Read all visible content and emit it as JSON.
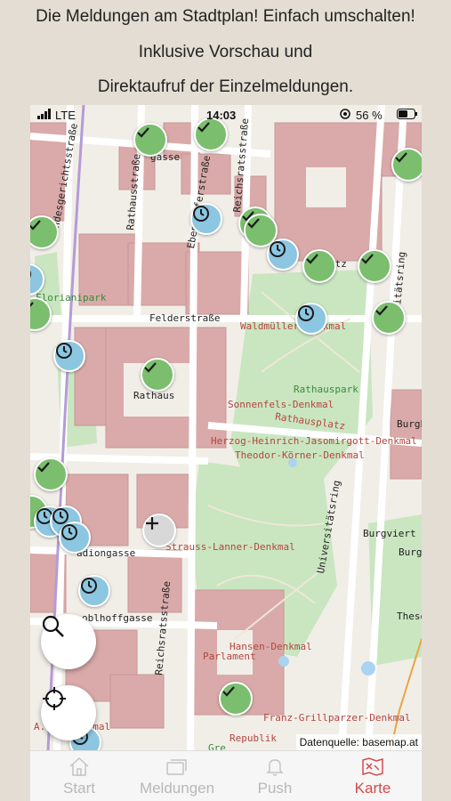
{
  "caption": {
    "line1": "Die Meldungen am Stadtplan! Einfach umschalten!",
    "line2": "Inklusive Vorschau und",
    "line3": "Direktaufruf der Einzelmeldungen."
  },
  "status_bar": {
    "carrier": "LTE",
    "time": "14:03",
    "battery": "56 %"
  },
  "map": {
    "labels": {
      "landesgerichtsstrasse": "Landesgerichtsstraße",
      "florianipark": "Florianipark",
      "gasse_top": "gasse",
      "rathausstrasse": "Rathausstraße",
      "ebendorferstrasse": "Ebendorferstraße",
      "reichsratsstrasse_top": "Reichsratsstraße",
      "felderstrasse": "Felderstraße",
      "waldmueller": "Waldmüller-Denkmal",
      "rathaus": "Rathaus",
      "rathauspark": "Rathauspark",
      "sonnenfels": "Sonnenfels-Denkmal",
      "rathausplatz": "Rathausplatz",
      "herzog": "Herzog-Heinrich-Jasomirgott-Denkmal",
      "koerner": "Theodor-Körner-Denkmal",
      "universitaetsring": "Universitätsring",
      "universitaetsring_top": "versitätsring",
      "burgviert": "Burgviert",
      "burg": "Burg",
      "theseu": "Theseu",
      "strauss": "Strauss-Lanner-Denkmal",
      "stadiongasse": "adiongasse",
      "reichsratsstrasse": "Reichsratsstraße",
      "doblhoffgasse": "oblhoffgasse",
      "hansen": "Hansen-Denkmal",
      "parlament": "Parlament",
      "grillparzer": "Franz-Grillparzer-Denkmal",
      "republik": "Republik",
      "denkmal_left": "A...r-Denkmal",
      "gre": "Gre",
      "platz": "atz",
      "burgher": "Burghe"
    },
    "source": "Datenquelle: basemap.at",
    "colors": {
      "done_marker": "#7bbe6e",
      "pending_marker": "#8cc6e0",
      "building": "#d9aaa9",
      "park": "#c8e6c0"
    }
  },
  "buttons": {
    "search_icon": "magnifier-icon",
    "locate_icon": "crosshair-icon",
    "add_icon": "plus-icon"
  },
  "tabbar": {
    "tabs": [
      {
        "label": "Start",
        "icon": "house-icon"
      },
      {
        "label": "Meldungen",
        "icon": "cards-icon"
      },
      {
        "label": "Push",
        "icon": "bell-icon"
      },
      {
        "label": "Karte",
        "icon": "map-icon"
      }
    ],
    "active": "Karte",
    "active_color": "#d64a4a"
  }
}
